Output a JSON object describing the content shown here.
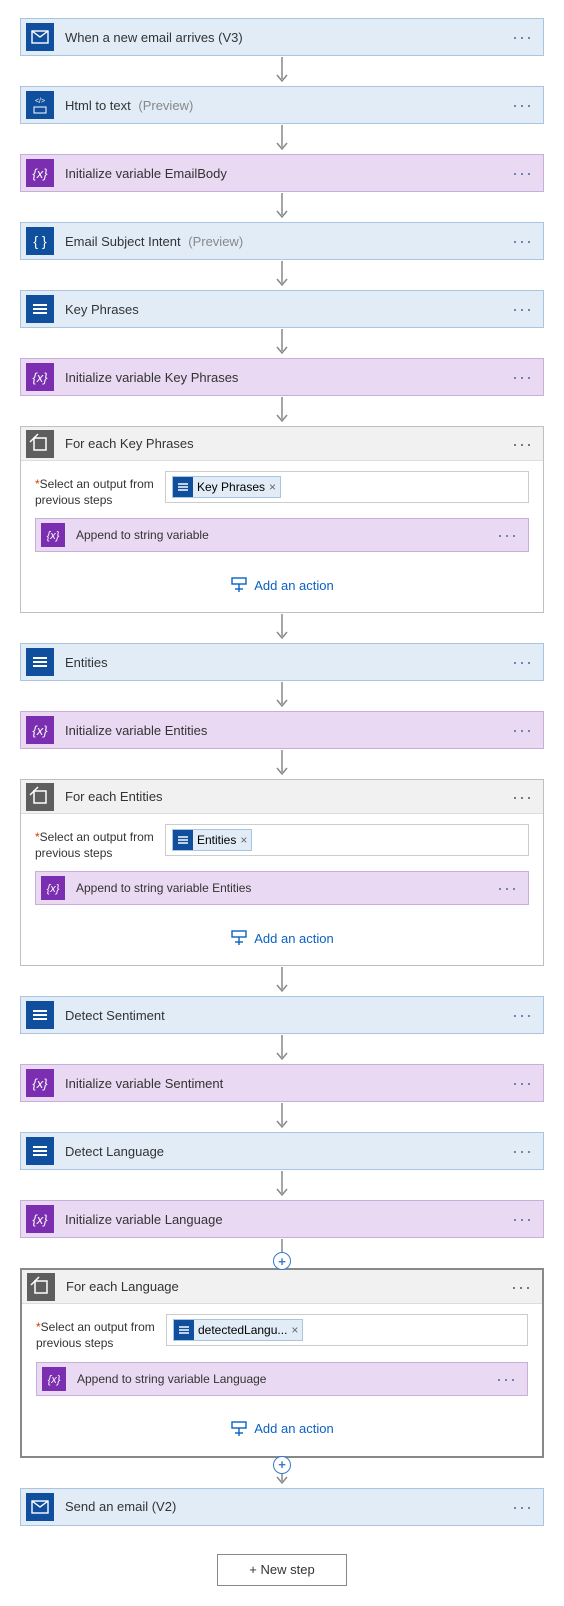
{
  "steps": {
    "trigger": {
      "label": "When a new email arrives (V3)"
    },
    "html": {
      "label": "Html to text",
      "preview": "(Preview)"
    },
    "varEmail": {
      "label": "Initialize variable EmailBody"
    },
    "intent": {
      "label": "Email Subject Intent",
      "preview": "(Preview)"
    },
    "keyphrases": {
      "label": "Key Phrases"
    },
    "varKP": {
      "label": "Initialize variable Key Phrases"
    },
    "forKP": {
      "label": "For each Key Phrases",
      "field": "Select an output from previous steps",
      "token": "Key Phrases",
      "inner": "Append to string variable",
      "add": "Add an action"
    },
    "entities": {
      "label": "Entities"
    },
    "varEnt": {
      "label": "Initialize variable Entities"
    },
    "forEnt": {
      "label": "For each Entities",
      "field": "Select an output from previous steps",
      "token": "Entities",
      "inner": "Append to string variable Entities",
      "add": "Add an action"
    },
    "sentiment": {
      "label": "Detect Sentiment"
    },
    "varSent": {
      "label": "Initialize variable Sentiment"
    },
    "language": {
      "label": "Detect Language"
    },
    "varLang": {
      "label": "Initialize variable Language"
    },
    "forLang": {
      "label": "For each Language",
      "field": "Select an output from previous steps",
      "token": "detectedLangu...",
      "inner": "Append to string variable Language",
      "add": "Add an action"
    },
    "send": {
      "label": "Send an email (V2)"
    }
  },
  "ui": {
    "newstep": "+ New step",
    "required": "*",
    "dots": "···",
    "tokenClose": "×"
  }
}
